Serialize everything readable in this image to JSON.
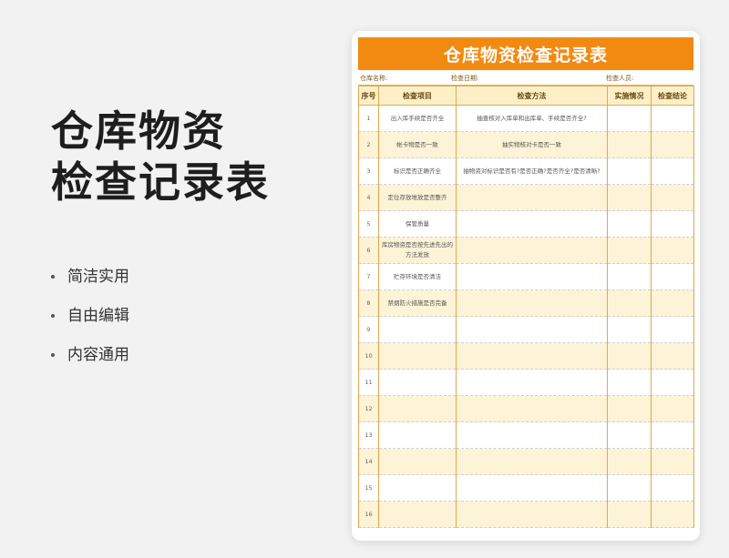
{
  "hero": {
    "title_line1": "仓库物资",
    "title_line2": "检查记录表"
  },
  "features": [
    "简洁实用",
    "自由编辑",
    "内容通用"
  ],
  "sheet": {
    "title": "仓库物资检查记录表",
    "warehouse_label": "仓库名称:",
    "date_label": "检查日期:",
    "inspector_label": "检查人员:",
    "headers": [
      "序号",
      "检查项目",
      "检查方法",
      "实施情况",
      "检查结论"
    ],
    "rows": [
      {
        "no": "1",
        "item": "出入库手续是否齐全",
        "method": "抽查核对入库单和出库单、手续是否齐全?"
      },
      {
        "no": "2",
        "item": "帐卡物是否一致",
        "method": "抽实物核对卡是否一致"
      },
      {
        "no": "3",
        "item": "标识是否正确齐全",
        "method": "抽物资对标识是否有?是否正确?是否齐全?是否清晰?"
      },
      {
        "no": "4",
        "item": "定位存放堆放是否整齐",
        "method": ""
      },
      {
        "no": "5",
        "item": "保管质量",
        "method": ""
      },
      {
        "no": "6",
        "item": "库房物资是否按先进先出的方法发放",
        "method": ""
      },
      {
        "no": "7",
        "item": "贮存环境是否清洁",
        "method": ""
      },
      {
        "no": "8",
        "item": "禁烟防火措施是否完备",
        "method": ""
      },
      {
        "no": "9",
        "item": "",
        "method": ""
      },
      {
        "no": "10",
        "item": "",
        "method": ""
      },
      {
        "no": "11",
        "item": "",
        "method": ""
      },
      {
        "no": "12",
        "item": "",
        "method": ""
      },
      {
        "no": "13",
        "item": "",
        "method": ""
      },
      {
        "no": "14",
        "item": "",
        "method": ""
      },
      {
        "no": "15",
        "item": "",
        "method": ""
      },
      {
        "no": "16",
        "item": "",
        "method": ""
      }
    ]
  },
  "colors": {
    "title_bar": "#f28a12",
    "header_bg": "#fdf0c8",
    "alt_row_bg": "#fdf3d6",
    "border": "#e0a850"
  }
}
